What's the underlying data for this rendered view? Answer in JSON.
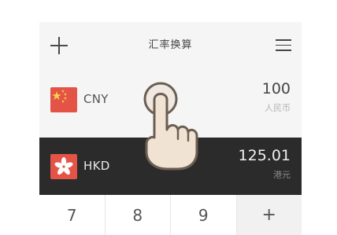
{
  "header": {
    "title": "汇率换算",
    "add_icon": "plus-icon",
    "menu_icon": "hamburger-menu-icon"
  },
  "rows": [
    {
      "code": "CNY",
      "amount": "100",
      "name": "人民币",
      "flag": "china-flag-icon",
      "selected": false
    },
    {
      "code": "HKD",
      "amount": "125.01",
      "name": "港元",
      "flag": "hong-kong-flag-icon",
      "selected": true
    }
  ],
  "keypad": {
    "keys": [
      "7",
      "8",
      "9",
      "+"
    ]
  },
  "colors": {
    "background": "#f5f5f5",
    "selected_row": "#2b2b2b",
    "flag_red": "#e45446",
    "hand_fill": "#f0e3d3",
    "hand_outline": "#6b5e52"
  }
}
